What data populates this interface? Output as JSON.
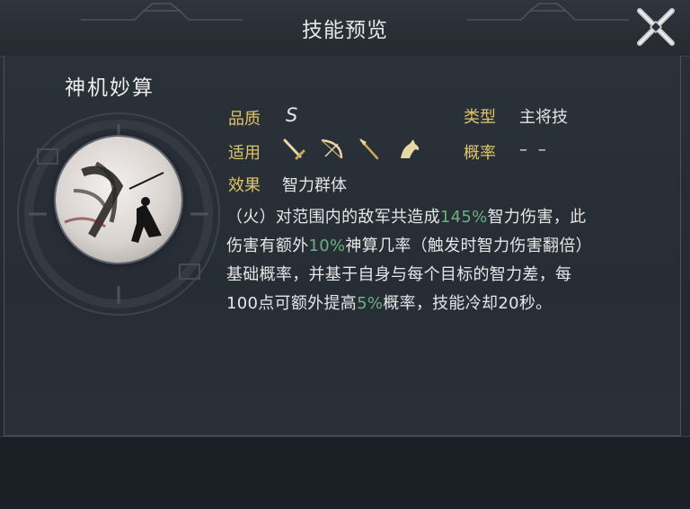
{
  "window": {
    "title": "技能预览",
    "close_icon": "close-icon"
  },
  "skill": {
    "name": "神机妙算",
    "icon": "ink-warrior-skill-icon",
    "quality_label": "品质",
    "quality_value": "S",
    "type_label": "类型",
    "type_value": "主将技",
    "applicable_label": "适用",
    "applicable_icons": [
      "sword-icon",
      "bow-icon",
      "spear-icon",
      "horse-icon"
    ],
    "probability_label": "概率",
    "probability_value": "– –",
    "effect_label": "效果",
    "effect_value": "智力群体",
    "description": {
      "line1_a": "（火）对范围内的敌军共造成",
      "line1_hl": "145%",
      "line1_b": "智力伤害，此",
      "line2_a": "伤害有额外",
      "line2_hl": "10%",
      "line2_b": "神算几率（触发时智力伤害翻倍）",
      "line3": "基础概率，并基于自身与每个目标的智力差，每",
      "line4_a": "100点可额外提高",
      "line4_hl": "5%",
      "line4_b": "概率，技能冷却20秒。"
    }
  },
  "colors": {
    "label": "#e0c46a",
    "highlight": "#6fae7e",
    "text": "#e6e6e6",
    "background": "#262c34"
  }
}
